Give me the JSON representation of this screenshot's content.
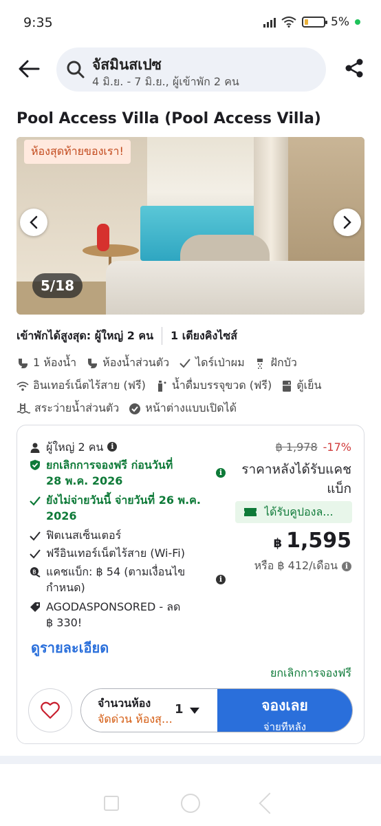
{
  "status_bar": {
    "time": "9:35",
    "battery": "5%"
  },
  "header": {
    "search_title": "จัสมินสเปซ",
    "search_subtitle": "4 มิ.ย. - 7 มิ.ย., ผู้เข้าพัก 2 คน"
  },
  "room": {
    "title": "Pool Access Villa (Pool Access Villa)",
    "gallery_tag": "ห้องสุดท้ายของเรา!",
    "gallery_counter": "5/18",
    "max_occupancy": "เข้าพักได้สูงสุด: ผู้ใหญ่ 2 คน",
    "bed": "1 เตียงคิงไซส์"
  },
  "amenities": {
    "row1": [
      "1 ห้องน้ำ",
      "ห้องน้ำส่วนตัว",
      "ไดร์เป่าผม",
      "ฝักบัว"
    ],
    "row2": [
      "อินเทอร์เน็ตไร้สาย (ฟรี)",
      "น้ำดื่มบรรจุขวด (ฟรี)",
      "ตู้เย็น"
    ],
    "row3": [
      "สระว่ายน้ำส่วนตัว",
      "หน้าต่างแบบเปิดได้"
    ]
  },
  "offer": {
    "guests": "ผู้ใหญ่ 2 คน",
    "free_cancel_line1": "ยกเลิกการจองฟรี ก่อนวันที่",
    "free_cancel_line2": "28 พ.ค. 2026",
    "pay_later_line1": "ยังไม่จ่ายวันนี้ จ่ายวันที่ 26 พ.ค.",
    "pay_later_line2": "2026",
    "fitness": "ฟิตเนสเซ็นเตอร์",
    "wifi": "ฟรีอินเทอร์เน็ตไร้สาย (Wi-Fi)",
    "cashback_line1": "แคชแบ็ก: ฿ 54 (ตามเงื่อนไข",
    "cashback_line2": "กำหนด)",
    "sponsored_line1": "AGODASPONSORED - ลด",
    "sponsored_line2": "฿ 330!",
    "details_link": "ดูรายละเอียด",
    "old_price": "฿ 1,978",
    "discount": "-17%",
    "after_cashback": "ราคาหลังได้รับแคชแบ็ก",
    "coupon": "ได้รับคูปองล...",
    "currency": "฿",
    "price": "1,595",
    "monthly": "หรือ ฿ 412/เดือน",
    "free_cancel_footer": "ยกเลิกการจองฟรี",
    "qty_label": "จำนวนห้อง",
    "qty_urgent": "จัดด่วน ห้องสุดท้าย",
    "qty_value": "1",
    "book_label": "จองเลย",
    "book_sub": "จ่ายทีหลัง"
  },
  "colors": {
    "accent_blue": "#2a6fdb",
    "green": "#0e7a38",
    "discount_red": "#d03b3b",
    "urgent_orange": "#d45a0f"
  }
}
